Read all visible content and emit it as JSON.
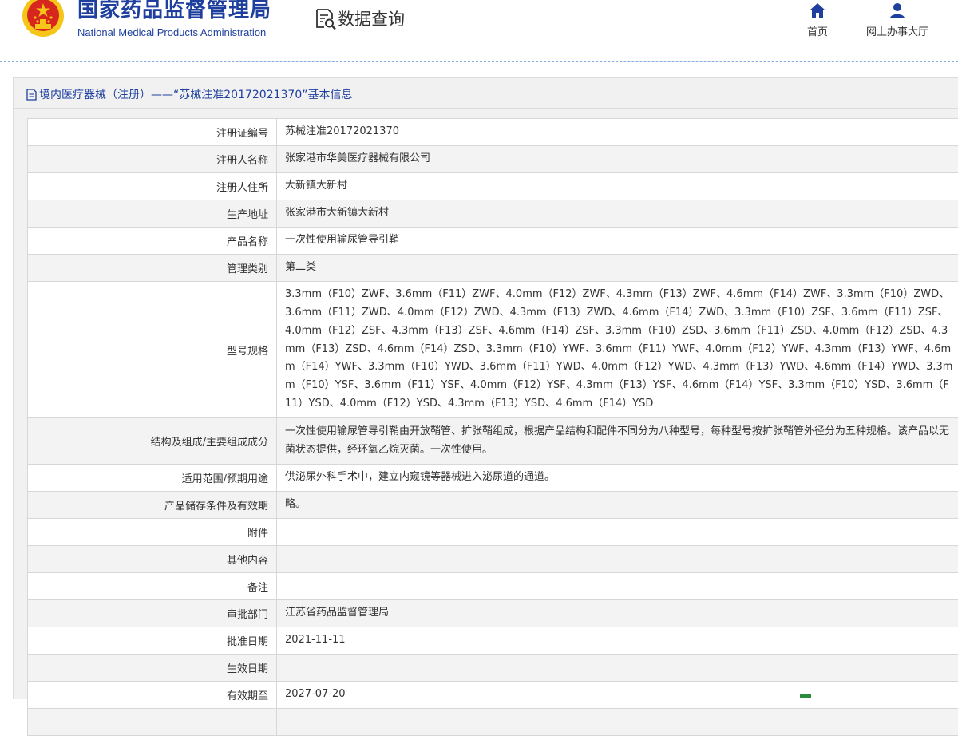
{
  "header": {
    "org_name_cn": "国家药品监督管理局",
    "org_name_en": "National Medical Products Administration",
    "section_title": "数据查询",
    "nav": {
      "home": "首页",
      "service_hall": "网上办事大厅"
    }
  },
  "panel": {
    "title": "境内医疗器械（注册）——“苏械注准20172021370”基本信息"
  },
  "rows": [
    {
      "label": "注册证编号",
      "value": "苏械注准20172021370"
    },
    {
      "label": "注册人名称",
      "value": "张家港市华美医疗器械有限公司"
    },
    {
      "label": "注册人住所",
      "value": "大新镇大新村"
    },
    {
      "label": "生产地址",
      "value": "张家港市大新镇大新村"
    },
    {
      "label": "产品名称",
      "value": "一次性使用输尿管导引鞘"
    },
    {
      "label": "管理类别",
      "value": "第二类"
    },
    {
      "label": "型号规格",
      "value": "3.3mm（F10）ZWF、3.6mm（F11）ZWF、4.0mm（F12）ZWF、4.3mm（F13）ZWF、4.6mm（F14）ZWF、3.3mm（F10）ZWD、3.6mm（F11）ZWD、4.0mm（F12）ZWD、4.3mm（F13）ZWD、4.6mm（F14）ZWD、3.3mm（F10）ZSF、3.6mm（F11）ZSF、4.0mm（F12）ZSF、4.3mm（F13）ZSF、4.6mm（F14）ZSF、3.3mm（F10）ZSD、3.6mm（F11）ZSD、4.0mm（F12）ZSD、4.3mm（F13）ZSD、4.6mm（F14）ZSD、3.3mm（F10）YWF、3.6mm（F11）YWF、4.0mm（F12）YWF、4.3mm（F13）YWF、4.6mm（F14）YWF、3.3mm（F10）YWD、3.6mm（F11）YWD、4.0mm（F12）YWD、4.3mm（F13）YWD、4.6mm（F14）YWD、3.3mm（F10）YSF、3.6mm（F11）YSF、4.0mm（F12）YSF、4.3mm（F13）YSF、4.6mm（F14）YSF、3.3mm（F10）YSD、3.6mm（F11）YSD、4.0mm（F12）YSD、4.3mm（F13）YSD、4.6mm（F14）YSD"
    },
    {
      "label": "结构及组成/主要组成成分",
      "value": "一次性使用输尿管导引鞘由开放鞘管、扩张鞘组成，根据产品结构和配件不同分为八种型号，每种型号按扩张鞘管外径分为五种规格。该产品以无菌状态提供，经环氧乙烷灭菌。一次性使用。"
    },
    {
      "label": "适用范围/预期用途",
      "value": "供泌尿外科手术中，建立内窥镜等器械进入泌尿道的通道。"
    },
    {
      "label": "产品储存条件及有效期",
      "value": "略。"
    },
    {
      "label": "附件",
      "value": ""
    },
    {
      "label": "其他内容",
      "value": ""
    },
    {
      "label": "备注",
      "value": ""
    },
    {
      "label": "审批部门",
      "value": "江苏省药品监督管理局"
    },
    {
      "label": "批准日期",
      "value": "2021-11-11"
    },
    {
      "label": "生效日期",
      "value": ""
    },
    {
      "label": "有效期至",
      "value": "2027-07-20"
    }
  ],
  "colors": {
    "brand_blue": "#1e3f9e",
    "emblem_red": "#d7261e",
    "emblem_gold": "#f5c518",
    "row_alt": "#f3f3f3",
    "border": "#d7d7d7",
    "panel_bg": "#f1f1f1"
  },
  "icons": {
    "emblem": "national-emblem-icon",
    "data_query": "document-search-icon",
    "home": "home-icon",
    "service_hall": "user-icon",
    "title": "document-icon"
  }
}
